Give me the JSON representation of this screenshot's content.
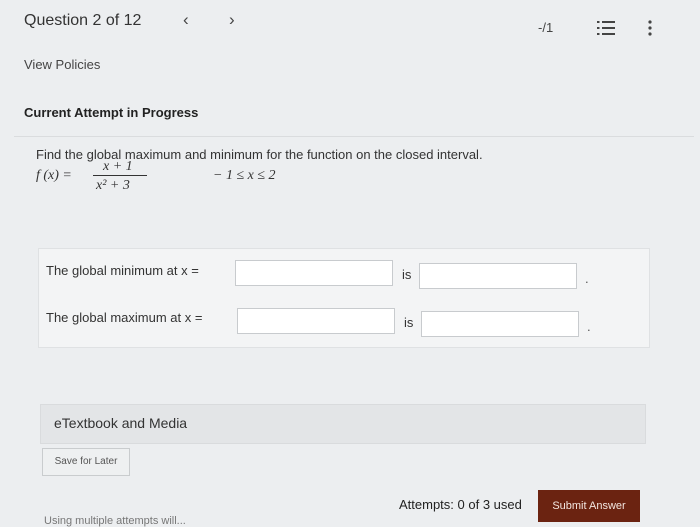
{
  "header": {
    "question_title": "Question 2 of 12",
    "prev_icon": "‹",
    "next_icon": "›",
    "score": "-/1"
  },
  "policies_link": "View Policies",
  "attempt_heading": "Current Attempt in Progress",
  "problem": {
    "prompt": "Find the global maximum and minimum for the function on the closed interval.",
    "function_lhs": "f (x)  =",
    "numerator": "x + 1",
    "denominator": "x² + 3",
    "interval": "− 1 ≤ x ≤ 2"
  },
  "answers": {
    "min_label": "The global minimum at  x  =",
    "max_label": "The global maximum at  x  =",
    "is_label": "is",
    "min_x_value": "",
    "min_value": "",
    "max_x_value": "",
    "max_value": ""
  },
  "etextbook_label": "eTextbook and Media",
  "save_label": "Save for Later",
  "attempts_text": "Attempts: 0 of 3 used",
  "submit_label": "Submit Answer",
  "footer_note": "Using multiple attempts will..."
}
